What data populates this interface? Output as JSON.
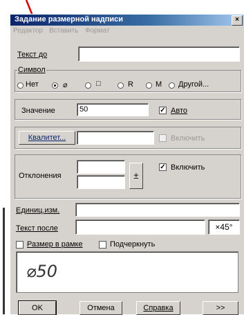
{
  "window": {
    "title": "Задание размерной надписи",
    "close": "×"
  },
  "menu": [
    "Редактор",
    "Вставить",
    "Формат"
  ],
  "text_before": {
    "label": "Текст до",
    "value": ""
  },
  "symbol": {
    "label": "Символ",
    "options": [
      {
        "label": "Нет",
        "selected": false
      },
      {
        "label": "⌀",
        "selected": true
      },
      {
        "label": "□",
        "selected": false
      },
      {
        "label": "R",
        "selected": false
      },
      {
        "label": "M",
        "selected": false
      },
      {
        "label": "Другой...",
        "selected": false
      }
    ]
  },
  "value": {
    "label": "Значение",
    "value": "50",
    "auto_label": "Авто",
    "auto_checked": true
  },
  "qualitet": {
    "button": "Квалитет...",
    "value": "",
    "enable_label": "Включить",
    "enable_checked": false
  },
  "deviations": {
    "label": "Отклонения",
    "upper": "",
    "lower": "",
    "pm_button": "±",
    "enable_label": "Включить",
    "enable_checked": true
  },
  "unit": {
    "label": "Единиц.изм.",
    "value": ""
  },
  "text_after": {
    "label": "Текст после",
    "value": "",
    "button": "×45°"
  },
  "options": {
    "framed_label": "Размер в рамке",
    "underline_label": "Подчеркнуть"
  },
  "preview": {
    "text": "⌀50"
  },
  "buttons": {
    "ok": "OK",
    "cancel": "Отмена",
    "help": "Справка",
    "more": ">>"
  },
  "colors": {
    "annotation_arrow": "#d40000",
    "titlebar": "#0a246a"
  }
}
